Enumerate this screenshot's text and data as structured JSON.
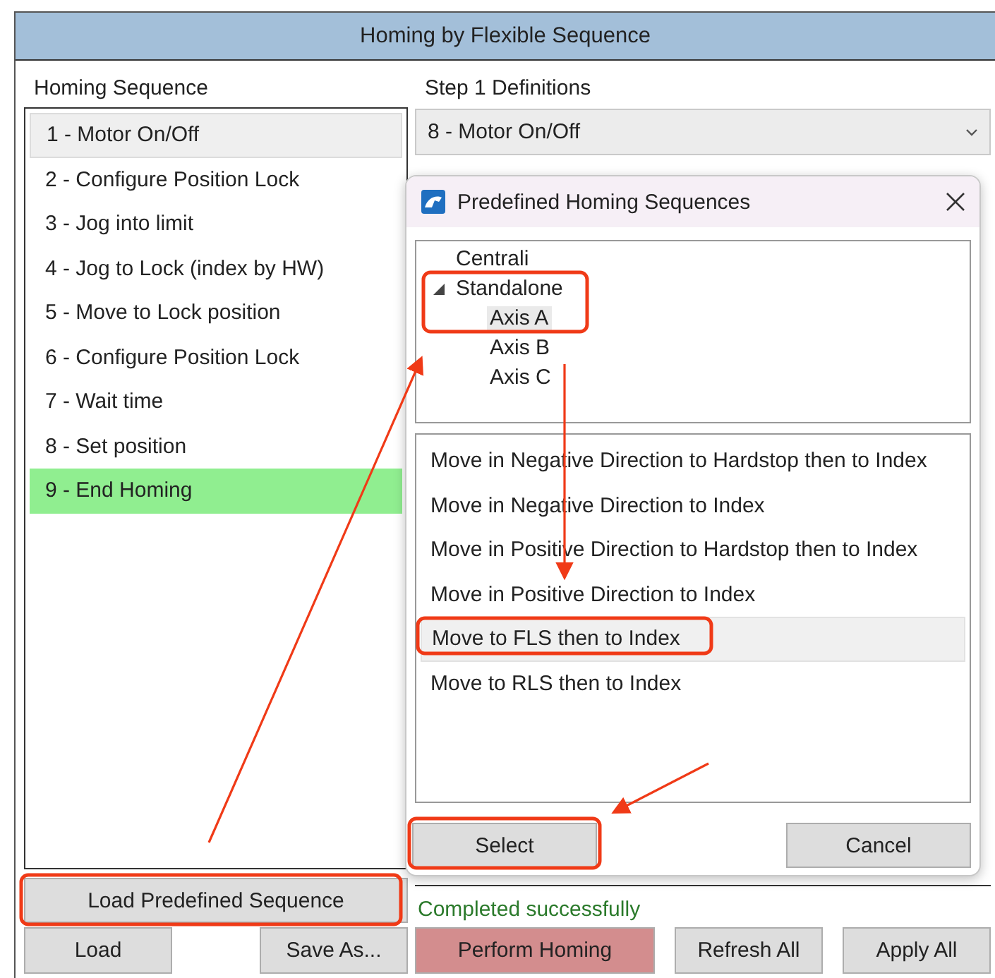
{
  "window": {
    "title": "Homing by Flexible Sequence"
  },
  "sequence": {
    "heading": "Homing Sequence",
    "steps": [
      {
        "label": "1 - Motor On/Off",
        "selected": true,
        "kind": "step"
      },
      {
        "label": "2 - Configure Position Lock",
        "selected": false,
        "kind": "step"
      },
      {
        "label": "3 - Jog into limit",
        "selected": false,
        "kind": "step"
      },
      {
        "label": "4 - Jog to Lock (index by HW)",
        "selected": false,
        "kind": "step"
      },
      {
        "label": "5 - Move to Lock position",
        "selected": false,
        "kind": "step"
      },
      {
        "label": "6 - Configure Position Lock",
        "selected": false,
        "kind": "step"
      },
      {
        "label": "7 - Wait time",
        "selected": false,
        "kind": "step"
      },
      {
        "label": "8 - Set position",
        "selected": false,
        "kind": "step"
      },
      {
        "label": "9 - End Homing",
        "selected": false,
        "kind": "end"
      }
    ],
    "load_predefined_button": {
      "label": "Load Predefined Sequence",
      "highlighted": true
    },
    "buttons": [
      "Load",
      "Save As..."
    ]
  },
  "definitions": {
    "heading": "Step 1 Definitions",
    "step_type": {
      "value": "8 - Motor On/Off"
    },
    "status": "Completed successfully",
    "buttons": [
      {
        "label": "Perform Homing",
        "kind": "primary"
      },
      {
        "label": "Refresh All",
        "kind": "normal"
      },
      {
        "label": "Apply All",
        "kind": "normal"
      }
    ]
  },
  "dialog": {
    "title": "Predefined Homing Sequences",
    "tree": [
      {
        "label": "Centrali",
        "selected": false
      },
      {
        "label": "Standalone",
        "selected": false,
        "expanded": true,
        "highlighted": true,
        "children": [
          {
            "label": "Axis A",
            "selected": true
          },
          {
            "label": "Axis B",
            "selected": false
          },
          {
            "label": "Axis C",
            "selected": false
          }
        ]
      }
    ],
    "sequences": [
      {
        "label": "Move in Negative Direction to Hardstop then to Index",
        "selected": false,
        "highlighted": false
      },
      {
        "label": "Move in Negative Direction to Index",
        "selected": false,
        "highlighted": false
      },
      {
        "label": "Move in Positive Direction to Hardstop then to Index",
        "selected": false,
        "highlighted": false
      },
      {
        "label": "Move in Positive Direction to Index",
        "selected": false,
        "highlighted": false
      },
      {
        "label": "Move to FLS then to Index",
        "selected": true,
        "highlighted": true
      },
      {
        "label": "Move to RLS then to Index",
        "selected": false,
        "highlighted": false
      }
    ],
    "select_button": {
      "label": "Select",
      "highlighted": true
    },
    "cancel_button": {
      "label": "Cancel"
    }
  }
}
